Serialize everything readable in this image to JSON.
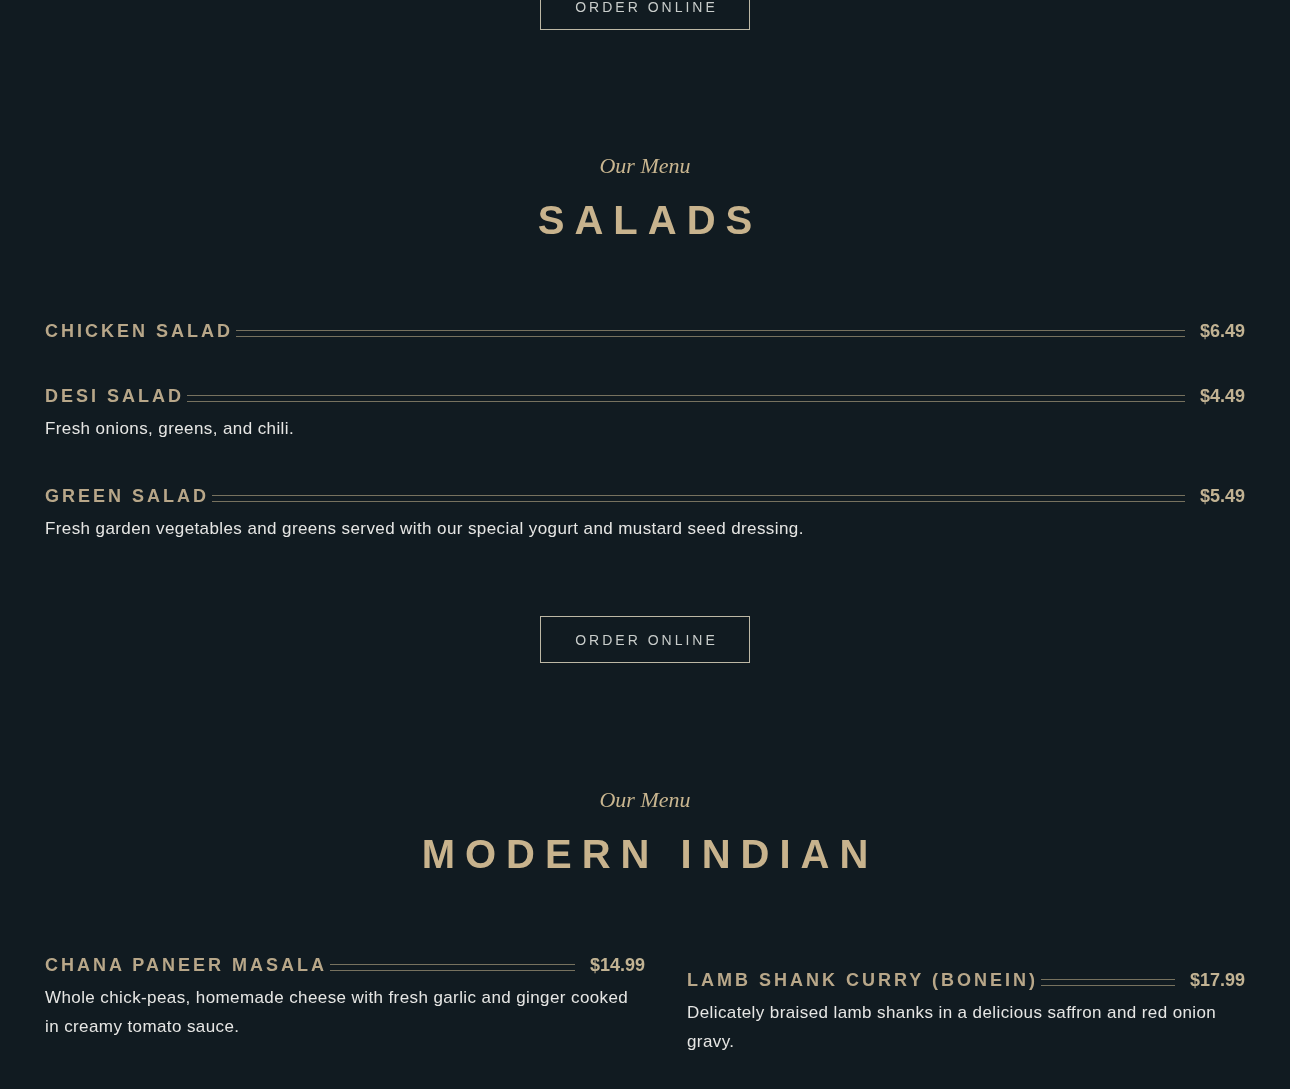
{
  "top_button": {
    "label": "ORDER ONLINE"
  },
  "sections": [
    {
      "subtitle": "Our Menu",
      "title": "SALADS",
      "columns": [
        [
          {
            "name": "CHICKEN SALAD",
            "price": "$6.49"
          },
          {
            "name": "DESI SALAD",
            "price": "$4.49",
            "description": "Fresh onions, greens, and chili."
          },
          {
            "name": "GREEN SALAD",
            "price": "$5.49",
            "description": "Fresh garden vegetables and greens served with our special yogurt and mustard seed dressing."
          }
        ]
      ],
      "button": {
        "label": "ORDER ONLINE"
      }
    },
    {
      "subtitle": "Our Menu",
      "title": "MODERN INDIAN",
      "columns": [
        [
          {
            "name": "CHANA PANEER MASALA",
            "price": "$14.99",
            "description": "Whole chick-peas, homemade cheese with fresh garlic and ginger cooked in creamy tomato sauce."
          }
        ],
        [
          {
            "name": "LAMB SHANK CURRY (BONEIN)",
            "price": "$17.99",
            "description": "Delicately braised lamb shanks in a delicious saffron and red onion gravy."
          }
        ]
      ]
    }
  ]
}
